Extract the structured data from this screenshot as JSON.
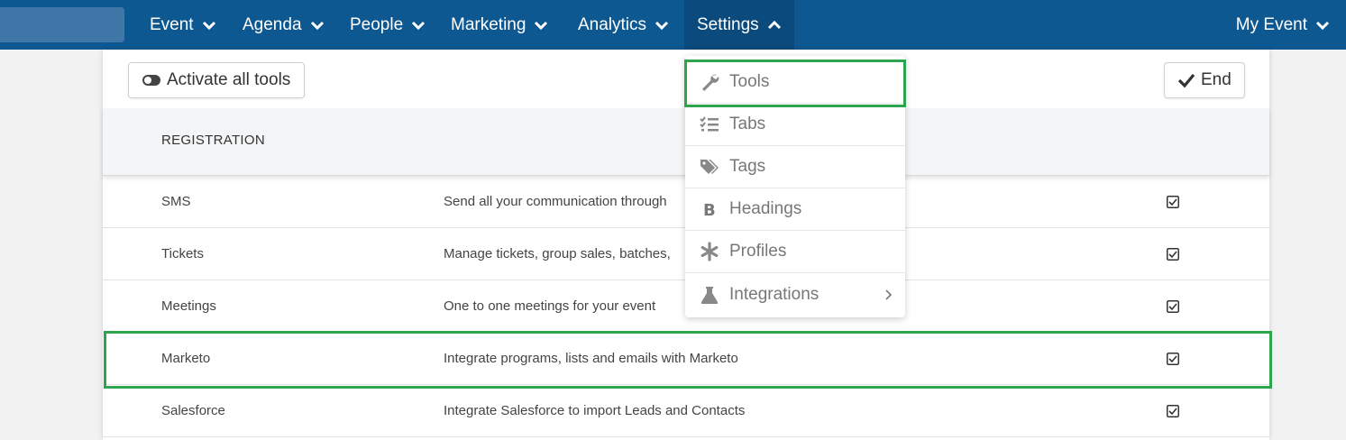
{
  "nav": {
    "items": [
      {
        "label": "Event"
      },
      {
        "label": "Agenda"
      },
      {
        "label": "People"
      },
      {
        "label": "Marketing"
      },
      {
        "label": "Analytics"
      },
      {
        "label": "Settings"
      }
    ],
    "right_label": "My Event"
  },
  "toolbar": {
    "activate_label": "Activate all tools",
    "end_label": "End"
  },
  "section": {
    "title": "REGISTRATION"
  },
  "rows": [
    {
      "name": "SMS",
      "description": "Send all your communication through",
      "enabled": true
    },
    {
      "name": "Tickets",
      "description": "Manage tickets, group sales, batches,",
      "enabled": true
    },
    {
      "name": "Meetings",
      "description": "One to one meetings for your event",
      "enabled": true
    },
    {
      "name": "Marketo",
      "description": "Integrate programs, lists and emails with Marketo",
      "enabled": true
    },
    {
      "name": "Salesforce",
      "description": "Integrate Salesforce to import Leads and Contacts",
      "enabled": true
    }
  ],
  "settings_menu": {
    "items": [
      {
        "label": "Tools",
        "icon": "wrench-icon"
      },
      {
        "label": "Tabs",
        "icon": "list-check-icon"
      },
      {
        "label": "Tags",
        "icon": "tags-icon"
      },
      {
        "label": "Headings",
        "icon": "bold-icon"
      },
      {
        "label": "Profiles",
        "icon": "asterisk-icon"
      },
      {
        "label": "Integrations",
        "icon": "flask-icon"
      }
    ]
  },
  "colors": {
    "nav_bg": "#0e5892",
    "highlight": "#2ea44f"
  }
}
